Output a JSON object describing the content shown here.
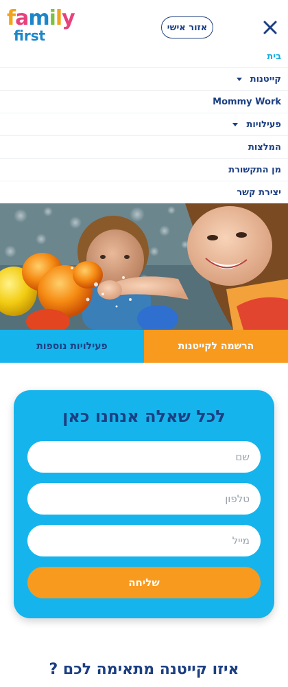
{
  "header": {
    "logo_top": [
      "f",
      "a",
      "m",
      "i",
      "l",
      "y"
    ],
    "logo_top_colors": [
      "#f3a41c",
      "#e8427c",
      "#1b87c9",
      "#7cc242",
      "#f3a41c",
      "#e8427c"
    ],
    "logo_bottom": "first",
    "personal_area_label": "אזור אישי",
    "close_icon": "close-icon"
  },
  "nav": {
    "items": [
      {
        "label": "בית",
        "active": true,
        "has_submenu": false
      },
      {
        "label": "קייטנות",
        "active": false,
        "has_submenu": true
      },
      {
        "label": "Mommy Work",
        "active": false,
        "has_submenu": false
      },
      {
        "label": "פעילויות",
        "active": false,
        "has_submenu": true
      },
      {
        "label": "המלצות",
        "active": false,
        "has_submenu": false
      },
      {
        "label": "מן התקשורת",
        "active": false,
        "has_submenu": false
      },
      {
        "label": "יצירת קשר",
        "active": false,
        "has_submenu": false
      }
    ]
  },
  "tabs": {
    "register_label": "הרשמה לקייטנות",
    "more_label": "פעילויות נוספות"
  },
  "contact": {
    "title": "לכל שאלה אנחנו כאן",
    "name_placeholder": "שם",
    "phone_placeholder": "טלפון",
    "email_placeholder": "מייל",
    "send_label": "שליחה"
  },
  "bottom_heading": "איזו קייטנה מתאימה לכם ?",
  "colors": {
    "navy": "#1c3f82",
    "sky": "#16b4ec",
    "orange": "#f79a1e",
    "active_nav": "#16aee2"
  }
}
